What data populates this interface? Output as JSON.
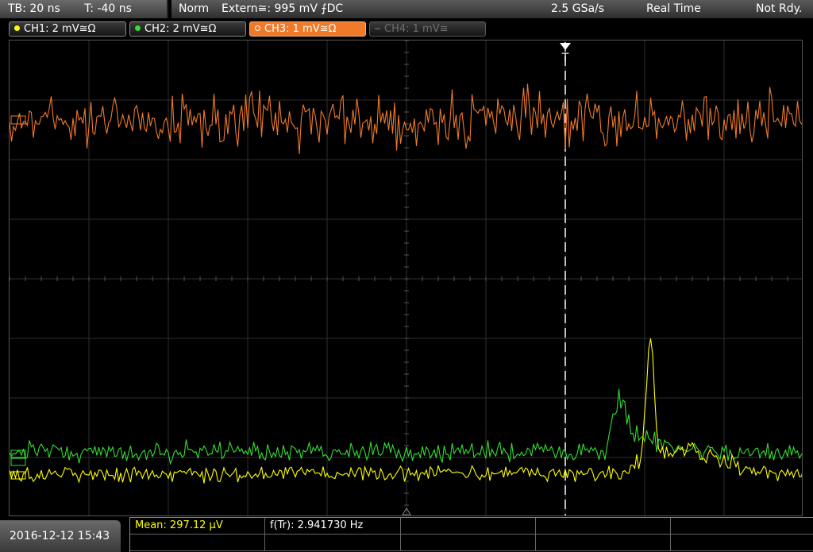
{
  "header": {
    "timebase": "TB: 20 ns",
    "trigger_time": "T: -40 ns",
    "mode": "Norm",
    "trigger_source": "Extern≅: 995 mV ⨍DC",
    "sample_rate": "2.5 GSa/s",
    "acq_mode": "Real Time",
    "status": "Not Rdy."
  },
  "channels": [
    {
      "label": "CH1: 2 mV≅Ω",
      "color": "#ffff00",
      "state": "normal"
    },
    {
      "label": "CH2: 2 mV≅Ω",
      "color": "#33dd33",
      "state": "normal"
    },
    {
      "label": "CH3: 1 mV≅Ω",
      "color": "#f07a2a",
      "state": "active"
    },
    {
      "label": "CH4: 1 mV≅",
      "color": "#6e6e6e",
      "state": "inactive"
    }
  ],
  "trigger_marker": "T",
  "footer": {
    "datetime": "2016-12-12 15:43",
    "mean": "Mean: 297.12 µV",
    "freq": "f(Tr): 2.941730 Hz"
  },
  "colors": {
    "ch1": "#ffff00",
    "ch2": "#33dd33",
    "ch3": "#f07a2a",
    "grid": "#3a3a3a",
    "trigger": "#ffffff"
  }
}
